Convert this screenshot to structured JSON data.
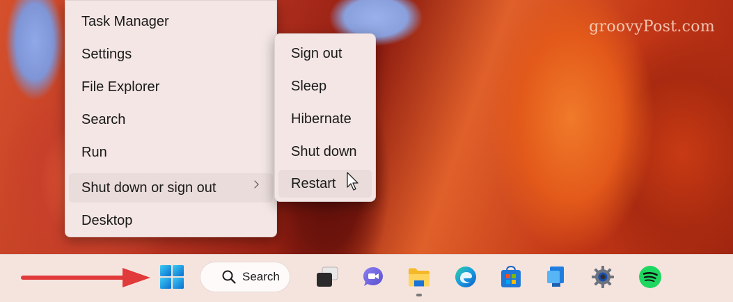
{
  "watermark": "groovyPost.com",
  "context_menu": {
    "items": [
      {
        "label": "Task Manager"
      },
      {
        "label": "Settings"
      },
      {
        "label": "File Explorer"
      },
      {
        "label": "Search"
      },
      {
        "label": "Run"
      },
      {
        "label": "Shut down or sign out",
        "has_submenu": true,
        "highlighted": true
      },
      {
        "label": "Desktop"
      }
    ]
  },
  "submenu": {
    "items": [
      {
        "label": "Sign out"
      },
      {
        "label": "Sleep"
      },
      {
        "label": "Hibernate"
      },
      {
        "label": "Shut down"
      },
      {
        "label": "Restart",
        "highlighted": true
      }
    ]
  },
  "taskbar": {
    "search_label": "Search",
    "apps": [
      "start-icon",
      "task-view-icon",
      "teams-chat-icon",
      "file-explorer-icon",
      "edge-icon",
      "microsoft-store-icon",
      "remote-desktop-icon",
      "settings-icon",
      "spotify-icon"
    ],
    "active_app": "file-explorer-icon"
  },
  "colors": {
    "menu_bg": "#f3e6e4",
    "highlight": "#e9dcda",
    "taskbar_bg": "#f5e3de",
    "arrow": "#e03a3a",
    "spotify": "#1ed760"
  }
}
